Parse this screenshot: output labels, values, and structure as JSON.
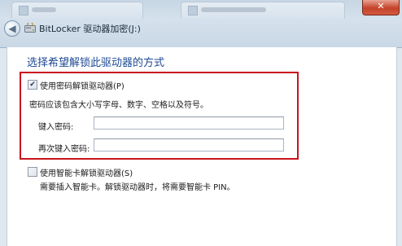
{
  "window": {
    "title": "BitLocker 驱动器加密(J:)",
    "close_label": "✕"
  },
  "dialog": {
    "heading": "选择希望解锁此驱动器的方式"
  },
  "password_option": {
    "label": "使用密码解锁驱动器(P)",
    "checked": true,
    "check_glyph": "✔",
    "hint": "密码应该包含大小写字母、数字、空格以及符号。",
    "enter_label": "键入密码:",
    "enter_value": "",
    "reenter_label": "再次键入密码:",
    "reenter_value": ""
  },
  "smartcard_option": {
    "label": "使用智能卡解锁驱动器(S)",
    "checked": false,
    "hint": "需要插入智能卡。解锁驱动器时，将需要智能卡 PIN。"
  },
  "colors": {
    "highlight": "#c8131f",
    "heading": "#1e4a94"
  }
}
